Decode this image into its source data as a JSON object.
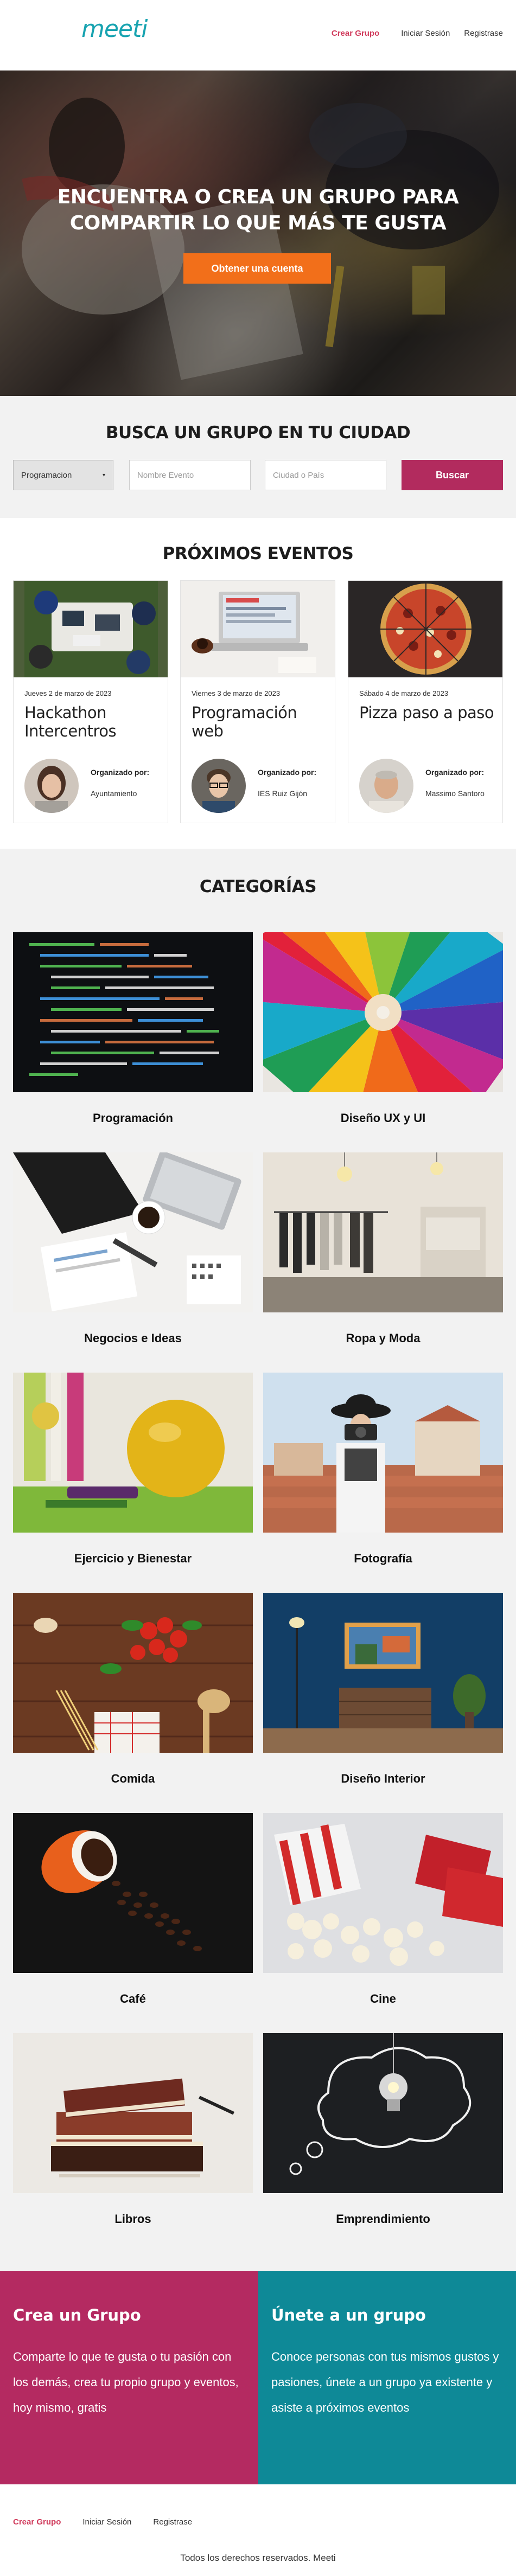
{
  "header": {
    "logo": "meeti",
    "nav": [
      "Crear Grupo",
      "Iniciar Sesión",
      "Registrase"
    ]
  },
  "hero": {
    "title_line1": "ENCUENTRA O CREA UN GRUPO PARA",
    "title_line2": "COMPARTIR LO QUE MÁS TE GUSTA",
    "button": "Obtener una cuenta"
  },
  "search": {
    "title": "BUSCA UN GRUPO EN TU CIUDAD",
    "category_selected": "Programacion",
    "name_placeholder": "Nombre Evento",
    "city_placeholder": "Ciudad o País",
    "button": "Buscar"
  },
  "events": {
    "title": "PRÓXIMOS EVENTOS",
    "items": [
      {
        "date": "Jueves 2 de marzo de 2023",
        "title": "Hackathon Intercentros",
        "org_label": "Organizado por:",
        "org": "Ayuntamiento"
      },
      {
        "date": "Viernes 3 de marzo de 2023",
        "title": "Programación web",
        "org_label": "Organizado por:",
        "org": "IES Ruiz Gijón"
      },
      {
        "date": "Sábado 4 de marzo de 2023",
        "title": "Pizza paso a paso",
        "org_label": "Organizado por:",
        "org": "Massimo Santoro"
      }
    ]
  },
  "categories": {
    "title": "CATEGORÍAS",
    "items": [
      "Programación",
      "Diseño UX y UI",
      "Negocios e Ideas",
      "Ropa y Moda",
      "Ejercicio y Bienestar",
      "Fotografía",
      "Comida",
      "Diseño Interior",
      "Café",
      "Cine",
      "Libros",
      "Emprendimiento"
    ]
  },
  "cta": {
    "create_title": "Crea un Grupo",
    "create_text": "Comparte lo que te gusta o tu pasión con los demás, crea tu propio grupo y eventos, hoy mismo, gratis",
    "join_title": "Únete a un grupo",
    "join_text": "Conoce personas con tus mismos gustos y pasiones, únete a un grupo ya existente y asiste a próximos eventos"
  },
  "footer": {
    "nav": [
      "Crear Grupo",
      "Iniciar Sesión",
      "Registrase"
    ],
    "copyright": "Todos los derechos reservados. Meeti"
  },
  "colors": {
    "brand": "#17a3b0",
    "accent_orange": "#f26f1a",
    "accent_pink": "#b22b5e",
    "teal": "#0e8997"
  }
}
